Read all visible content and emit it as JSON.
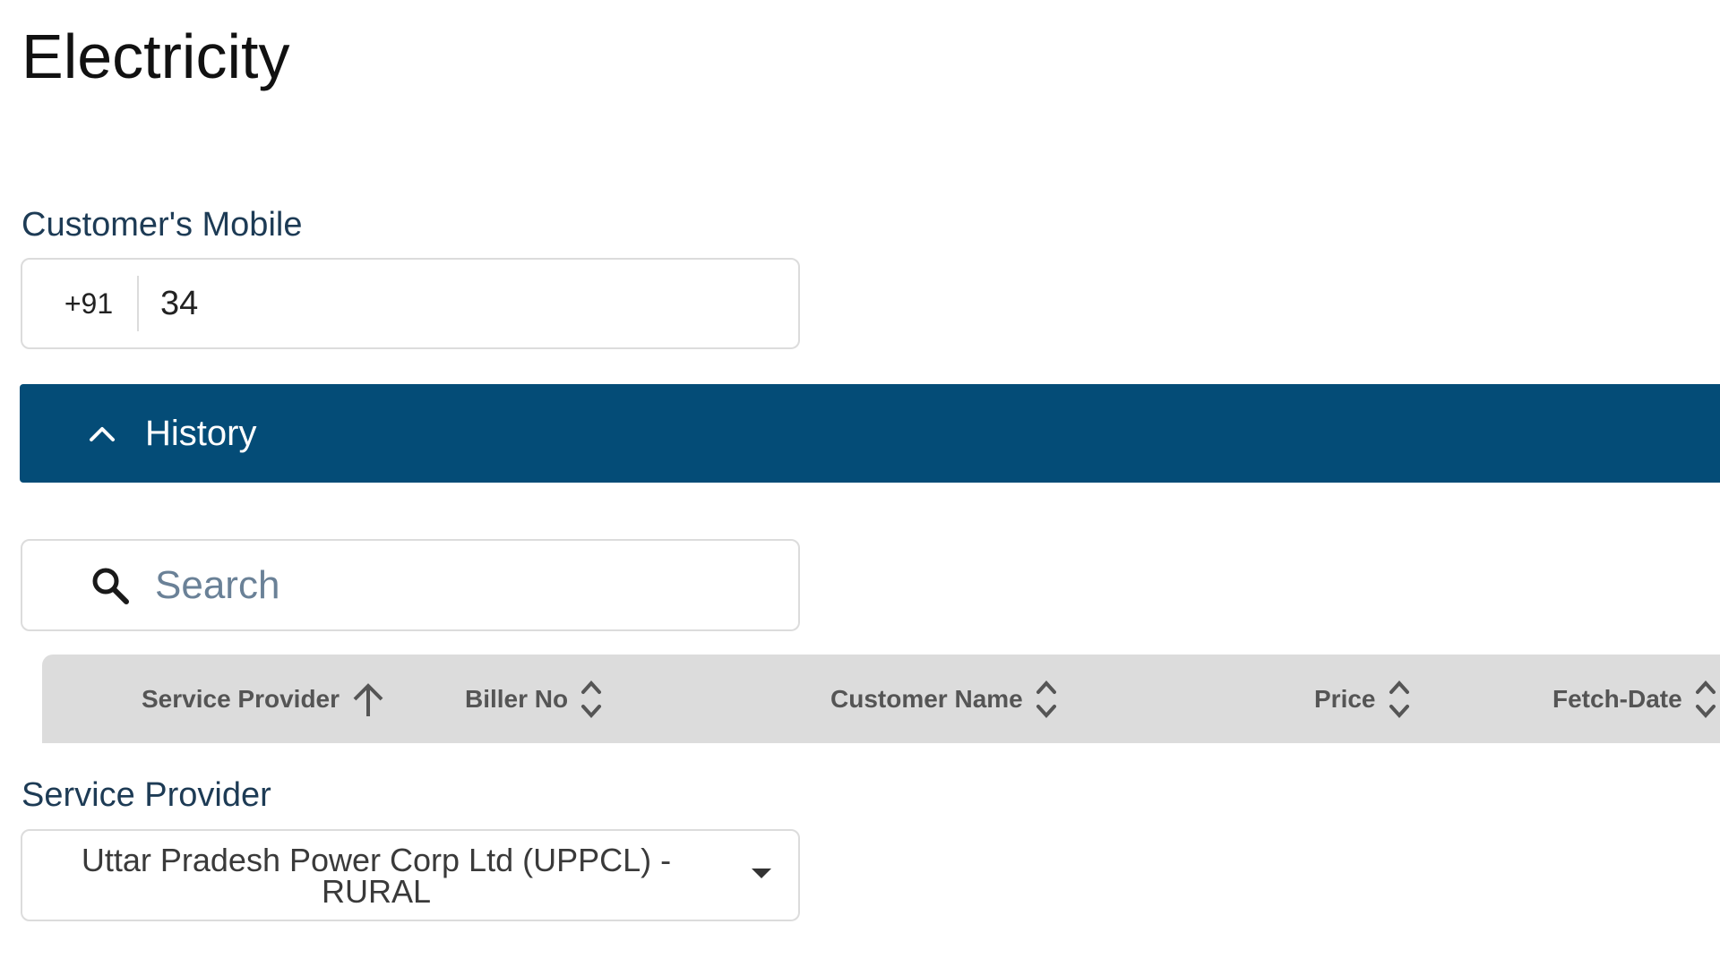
{
  "page": {
    "title": "Electricity"
  },
  "mobile": {
    "label": "Customer's Mobile",
    "country_code": "+91",
    "value": "34"
  },
  "history": {
    "label": "History",
    "expanded": true,
    "bar_color": "#044c77"
  },
  "search": {
    "placeholder": "Search"
  },
  "table": {
    "columns": [
      {
        "label": "Service Provider",
        "sort": "ascending"
      },
      {
        "label": "Biller No",
        "sort": "none"
      },
      {
        "label": "Customer Name",
        "sort": "none"
      },
      {
        "label": "Price",
        "sort": "none"
      },
      {
        "label": "Fetch-Date",
        "sort": "none"
      }
    ]
  },
  "service_provider": {
    "label": "Service Provider",
    "selected": "Uttar Pradesh Power Corp Ltd (UPPCL) - RURAL"
  },
  "icons": {
    "history_toggle": "chevron-up-icon",
    "search": "search-icon",
    "sort_asc": "arrow-up-icon",
    "sort_none": "sort-icon",
    "dropdown": "caret-down-icon"
  }
}
